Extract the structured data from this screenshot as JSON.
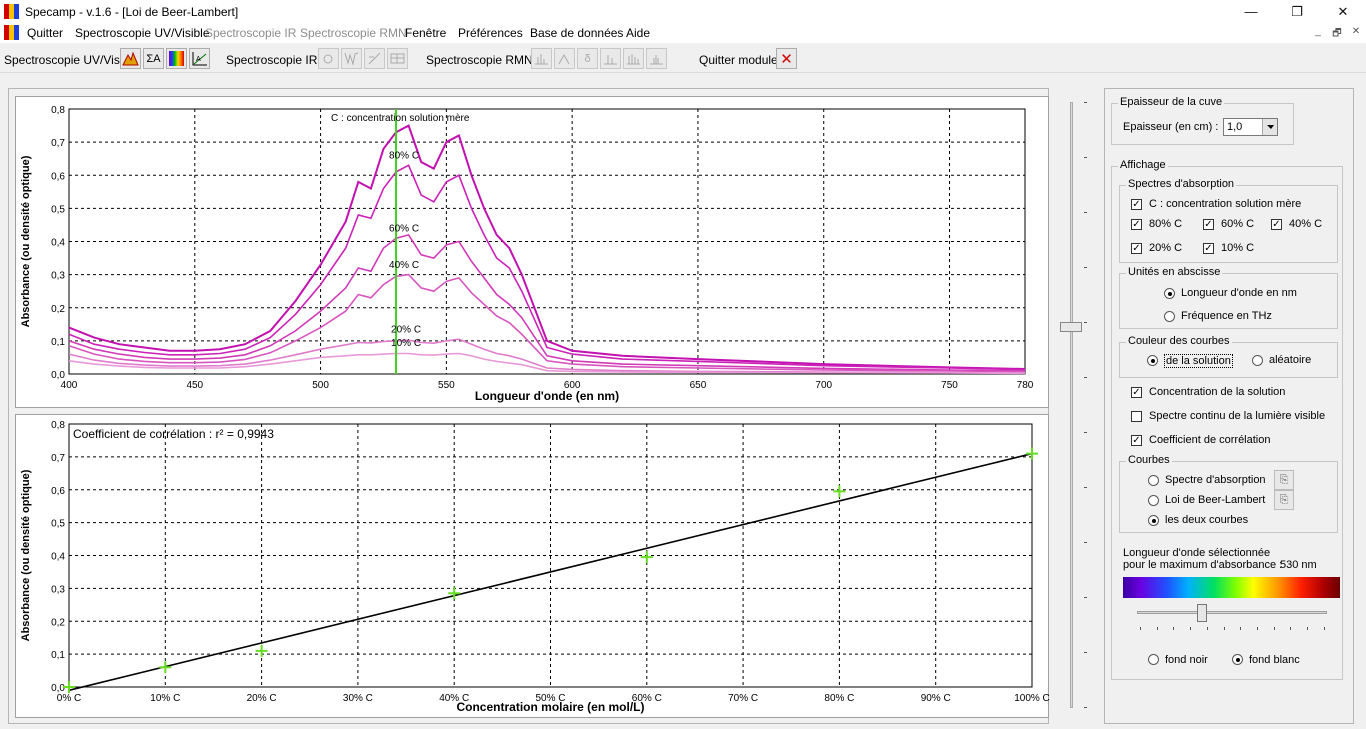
{
  "window": {
    "title": "Specamp - v.1.6 - [Loi de Beer-Lambert]",
    "minimize": "—",
    "maximize": "❐",
    "close": "✕"
  },
  "menu": {
    "items": [
      "Quitter",
      "Spectroscopie UV/Visible",
      "Spectroscopie IR",
      "Spectroscopie RMN",
      "Fenêtre",
      "Préférences",
      "Base de données",
      "Aide"
    ],
    "disabled": [
      "Spectroscopie IR",
      "Spectroscopie RMN"
    ],
    "mdi_minimize": "_",
    "mdi_restore": "🗗",
    "mdi_close": "✕"
  },
  "toolbar": {
    "uv_label": "Spectroscopie UV/Vis :",
    "uv_sigma": "ΣA",
    "ir_label": "Spectroscopie IR :",
    "rmn_label": "Spectroscopie RMN :",
    "rmn_delta": "δ",
    "quit_label": "Quitter module :",
    "quit_icon": "✕"
  },
  "chart_data": [
    {
      "type": "line",
      "xlabel": "Longueur d'onde (en nm)",
      "ylabel": "Absorbance (ou densité optique)",
      "xlim": [
        400,
        780
      ],
      "ylim": [
        0,
        0.8
      ],
      "x_ticks": [
        "400",
        "450",
        "500",
        "550",
        "600",
        "650",
        "700",
        "750",
        "780"
      ],
      "y_ticks": [
        "0,0",
        "0,1",
        "0,2",
        "0,3",
        "0,4",
        "0,5",
        "0,6",
        "0,7",
        "0,8"
      ],
      "grid": true,
      "selected_wavelength": 530,
      "x": [
        400,
        410,
        420,
        430,
        440,
        450,
        460,
        470,
        480,
        490,
        500,
        510,
        515,
        520,
        525,
        530,
        535,
        540,
        545,
        550,
        555,
        560,
        565,
        570,
        575,
        580,
        590,
        600,
        620,
        650,
        700,
        750,
        780
      ],
      "series": [
        {
          "name": "C : concentration solution mère",
          "color": "#c211b0",
          "values": [
            0.14,
            0.11,
            0.09,
            0.08,
            0.07,
            0.07,
            0.075,
            0.09,
            0.13,
            0.22,
            0.33,
            0.46,
            0.58,
            0.56,
            0.68,
            0.73,
            0.75,
            0.64,
            0.62,
            0.7,
            0.72,
            0.6,
            0.5,
            0.42,
            0.38,
            0.3,
            0.1,
            0.07,
            0.055,
            0.045,
            0.03,
            0.02,
            0.015
          ]
        },
        {
          "name": "80% C",
          "color": "#cc22b8",
          "values": [
            0.12,
            0.09,
            0.075,
            0.065,
            0.058,
            0.058,
            0.062,
            0.075,
            0.11,
            0.18,
            0.27,
            0.38,
            0.48,
            0.47,
            0.56,
            0.61,
            0.63,
            0.54,
            0.52,
            0.58,
            0.6,
            0.5,
            0.42,
            0.35,
            0.32,
            0.25,
            0.08,
            0.06,
            0.045,
            0.038,
            0.025,
            0.018,
            0.013
          ]
        },
        {
          "name": "60% C",
          "color": "#d23ab8",
          "values": [
            0.1,
            0.075,
            0.06,
            0.05,
            0.045,
            0.045,
            0.048,
            0.058,
            0.085,
            0.13,
            0.19,
            0.26,
            0.32,
            0.31,
            0.38,
            0.41,
            0.42,
            0.36,
            0.35,
            0.39,
            0.4,
            0.34,
            0.29,
            0.24,
            0.21,
            0.17,
            0.055,
            0.04,
            0.03,
            0.025,
            0.017,
            0.012,
            0.009
          ]
        },
        {
          "name": "40% C",
          "color": "#d855c0",
          "values": [
            0.085,
            0.06,
            0.045,
            0.038,
            0.034,
            0.034,
            0.036,
            0.044,
            0.064,
            0.1,
            0.14,
            0.19,
            0.24,
            0.23,
            0.27,
            0.295,
            0.3,
            0.26,
            0.25,
            0.28,
            0.29,
            0.245,
            0.21,
            0.175,
            0.155,
            0.12,
            0.04,
            0.03,
            0.022,
            0.018,
            0.012,
            0.009,
            0.007
          ]
        },
        {
          "name": "20% C",
          "color": "#e07ccc",
          "values": [
            0.06,
            0.042,
            0.032,
            0.027,
            0.024,
            0.024,
            0.025,
            0.03,
            0.042,
            0.058,
            0.075,
            0.088,
            0.095,
            0.094,
            0.098,
            0.1,
            0.102,
            0.095,
            0.093,
            0.1,
            0.105,
            0.09,
            0.075,
            0.062,
            0.055,
            0.045,
            0.018,
            0.014,
            0.01,
            0.008,
            0.006,
            0.004,
            0.003
          ]
        },
        {
          "name": "10% C",
          "color": "#e89ad8",
          "values": [
            0.04,
            0.03,
            0.024,
            0.02,
            0.018,
            0.018,
            0.018,
            0.022,
            0.03,
            0.04,
            0.05,
            0.055,
            0.058,
            0.058,
            0.06,
            0.062,
            0.062,
            0.058,
            0.057,
            0.06,
            0.062,
            0.055,
            0.045,
            0.038,
            0.033,
            0.028,
            0.01,
            0.008,
            0.006,
            0.005,
            0.004,
            0.003,
            0.002
          ]
        }
      ],
      "annotations": [
        "C : concentration solution mère",
        "80% C",
        "60% C",
        "40% C",
        "20% C",
        "10% C"
      ]
    },
    {
      "type": "scatter",
      "title": "Coefficient de corrélation : r² = 0,9943",
      "xlabel": "Concentration molaire (en mol/L)",
      "ylabel": "Absorbance (ou densité optique)",
      "categories": [
        "0% C",
        "10% C",
        "20% C",
        "30% C",
        "40% C",
        "50% C",
        "60% C",
        "70% C",
        "80% C",
        "90% C",
        "100% C"
      ],
      "y_ticks": [
        "0,0",
        "0,1",
        "0,2",
        "0,3",
        "0,4",
        "0,5",
        "0,6",
        "0,7",
        "0,8"
      ],
      "ylim": [
        0,
        0.8
      ],
      "grid": true,
      "points": {
        "x": [
          0,
          10,
          20,
          40,
          60,
          80,
          100
        ],
        "y": [
          0.0,
          0.06,
          0.11,
          0.285,
          0.395,
          0.595,
          0.71
        ]
      },
      "fit_line": {
        "from": [
          0,
          -0.01
        ],
        "to": [
          100,
          0.71
        ],
        "color": "#000000"
      },
      "point_color": "#66dd22"
    }
  ],
  "panel": {
    "cuve_group": "Epaisseur de la cuve",
    "cuve_label": "Epaisseur  (en cm) :",
    "cuve_value": "1,0",
    "affichage_group": "Affichage",
    "spectres_group": "Spectres d'absorption",
    "spectre_mere": "C : concentration solution mère",
    "spectre_80": "80% C",
    "spectre_60": "60% C",
    "spectre_40": "40% C",
    "spectre_20": "20% C",
    "spectre_10": "10% C",
    "unites_group": "Unités en abscisse",
    "unite_nm": "Longueur d'onde en nm",
    "unite_thz": "Fréquence en THz",
    "couleur_group": "Couleur des courbes",
    "couleur_solution": "de la solution",
    "couleur_aleatoire": "aléatoire",
    "conc_solution": "Concentration de la solution",
    "spectre_continu": "Spectre continu de la lumière visible",
    "coef_correlation": "Coefficient de corrélation",
    "courbes_group": "Courbes",
    "courbe_spectre": "Spectre d'absorption",
    "courbe_loi": "Loi de Beer-Lambert",
    "courbe_deux": "les deux courbes",
    "lambda_line1": "Longueur d'onde sélectionnée",
    "lambda_line2": "pour le maximum d'absorbance :",
    "lambda_value": "530 nm",
    "lambda_slider_fraction": 0.34,
    "fond_noir": "fond noir",
    "fond_blanc": "fond blanc",
    "check_mark": "✓",
    "copy_icon": "⎘"
  }
}
